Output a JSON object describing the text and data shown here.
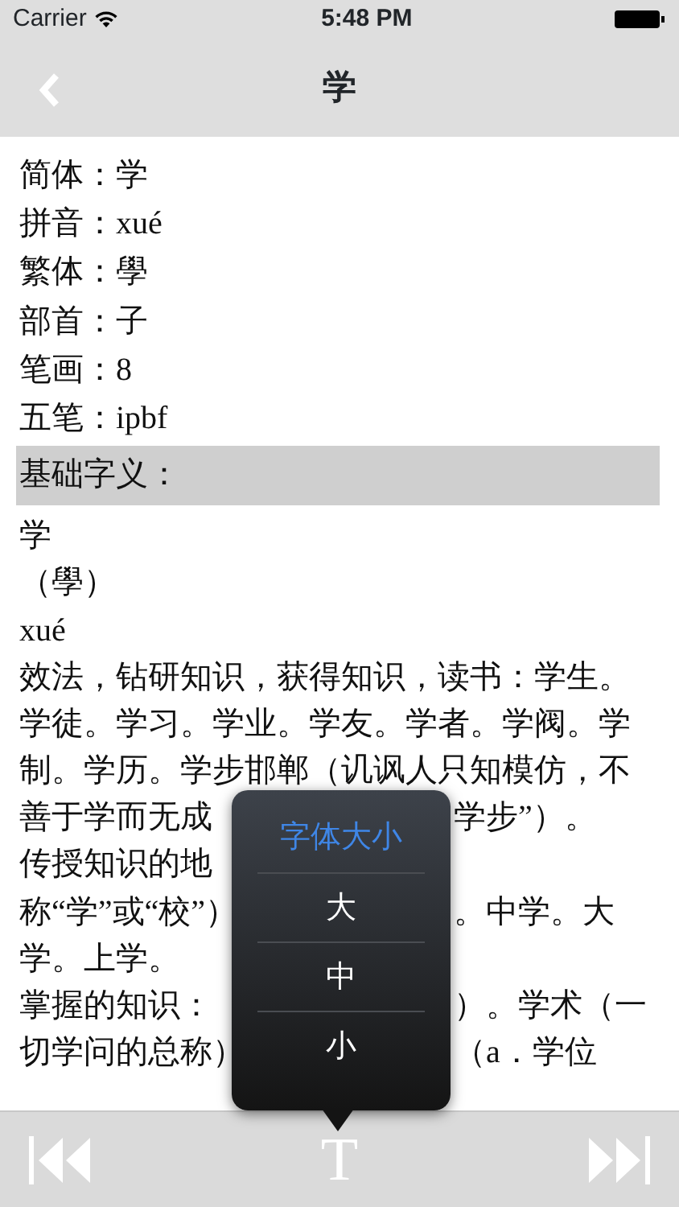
{
  "status_bar": {
    "carrier": "Carrier",
    "time": "5:48 PM"
  },
  "nav": {
    "title": "学"
  },
  "content": [
    {
      "kind": "line",
      "text": "简体：学"
    },
    {
      "kind": "line",
      "text": "拼音：xué"
    },
    {
      "kind": "line",
      "text": "繁体：學"
    },
    {
      "kind": "line",
      "text": "部首：子"
    },
    {
      "kind": "line",
      "text": "笔画：8"
    },
    {
      "kind": "line",
      "text": "五笔：ipbf"
    },
    {
      "kind": "heading",
      "text": "基础字义："
    },
    {
      "kind": "line",
      "text": "学"
    },
    {
      "kind": "line",
      "text": "（學）"
    },
    {
      "kind": "line",
      "text": "xué"
    },
    {
      "kind": "line",
      "text": "效法，钻研知识，获得知识，读书：学生。"
    },
    {
      "kind": "line",
      "text": "学徒。学习。学业。学友。学者。学阀。学"
    },
    {
      "kind": "line",
      "text": "制。学历。学步邯郸（讥讽人只知模仿，不"
    },
    {
      "kind": "split",
      "left": "善于学而无成",
      "right": "学步”）。"
    },
    {
      "kind": "split",
      "left": "传授知识的地"
    },
    {
      "kind": "split",
      "left": "称“学”或“校”）",
      "right": "。中学。大"
    },
    {
      "kind": "line",
      "text": "学。上学。"
    },
    {
      "kind": "split",
      "left": "掌握的知识：",
      "right": "）。学术（一"
    },
    {
      "kind": "split",
      "left": "切学问的总称）",
      "right": "（a．学位"
    }
  ],
  "popover": {
    "title": "字体大小",
    "options": [
      "大",
      "中",
      "小"
    ]
  },
  "toolbar": {
    "font_button": "T"
  }
}
